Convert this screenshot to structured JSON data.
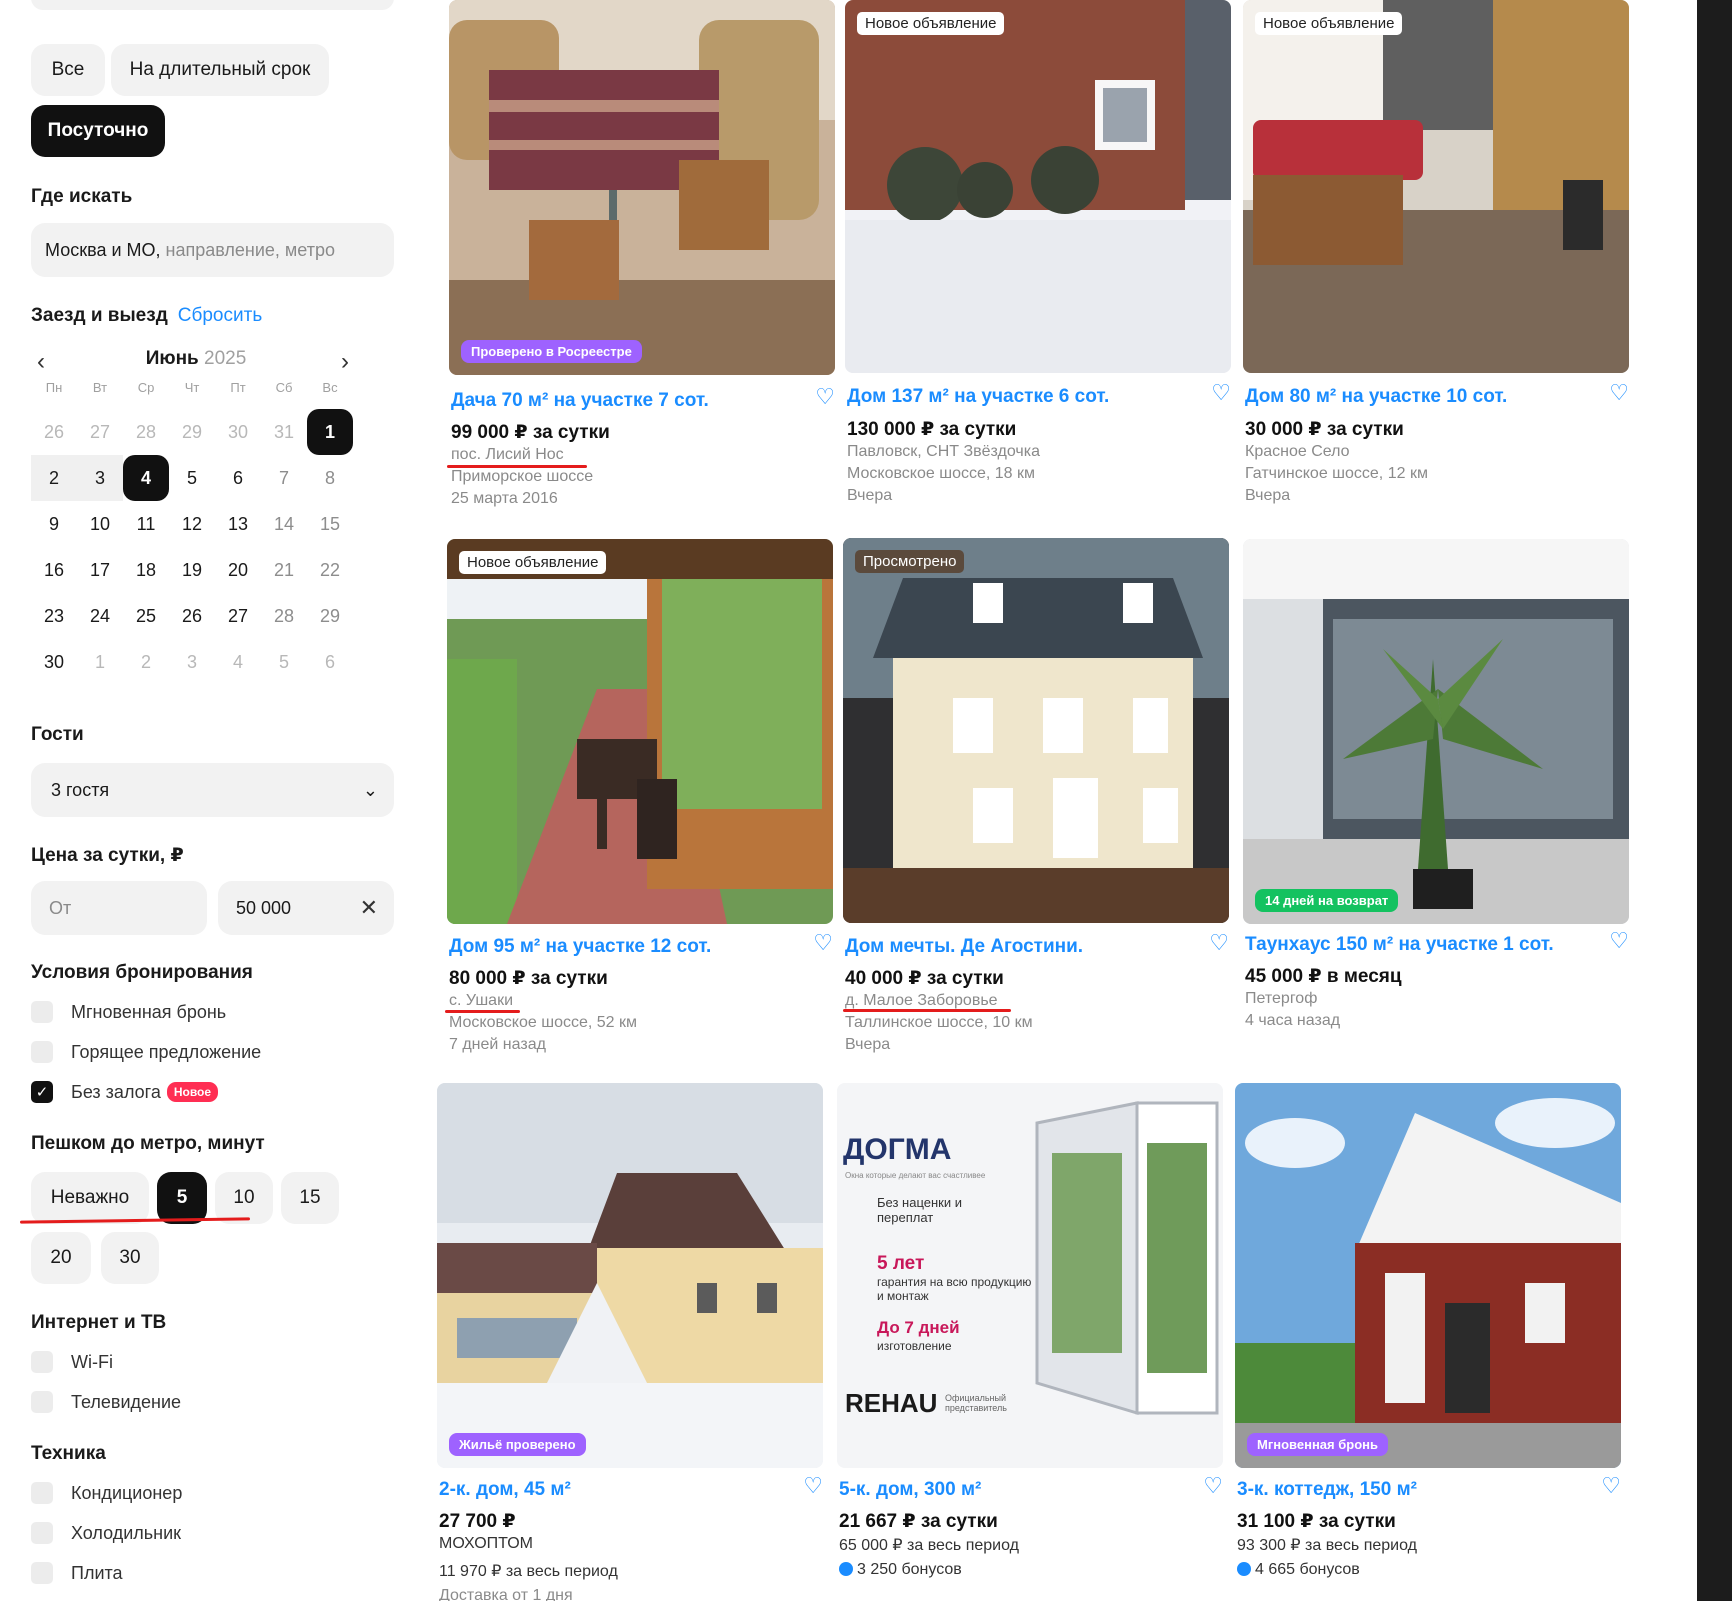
{
  "rent_type": {
    "all_label": "Все",
    "long_term_label": "На длительный срок",
    "daily_label": "Посуточно"
  },
  "where": {
    "title": "Где искать",
    "value": "Москва и МО,",
    "placeholder": "направление, метро"
  },
  "dates": {
    "title": "Заезд и выезд",
    "reset_label": "Сбросить",
    "month": "Июнь",
    "year": "2025",
    "weekdays": [
      "Пн",
      "Вт",
      "Ср",
      "Чт",
      "Пт",
      "Сб",
      "Вс"
    ],
    "days": [
      "26",
      "27",
      "28",
      "29",
      "30",
      "31",
      "1",
      "2",
      "3",
      "4",
      "5",
      "6",
      "7",
      "8",
      "9",
      "10",
      "11",
      "12",
      "13",
      "14",
      "15",
      "16",
      "17",
      "18",
      "19",
      "20",
      "21",
      "22",
      "23",
      "24",
      "25",
      "26",
      "27",
      "28",
      "29",
      "30",
      "1",
      "2",
      "3",
      "4",
      "5",
      "6"
    ]
  },
  "guests": {
    "title": "Гости",
    "value": "3 гостя"
  },
  "price": {
    "title": "Цена за сутки, ₽",
    "from_placeholder": "От",
    "to_value": "50 000"
  },
  "booking": {
    "title": "Условия бронирования",
    "instant": "Мгновенная бронь",
    "hot": "Горящее предложение",
    "no_deposit": "Без залога",
    "new_badge": "Новое"
  },
  "metro": {
    "title": "Пешком до метро, минут",
    "options": [
      "Неважно",
      "5",
      "10",
      "15",
      "20",
      "30"
    ]
  },
  "internet": {
    "title": "Интернет и ТВ",
    "wifi": "Wi-Fi",
    "tv": "Телевидение"
  },
  "appliances": {
    "title": "Техника",
    "ac": "Кондиционер",
    "fridge": "Холодильник",
    "stove": "Плита"
  },
  "cards": [
    {
      "title": "Дача 70 м² на участке 7 сот.",
      "price": "99 000 ₽ за сутки",
      "lines": [
        "пос. Лисий Нос",
        "Приморское шоссе",
        "25 марта 2016"
      ],
      "tag": "Проверено в Росреестре"
    },
    {
      "badge": "Новое объявление",
      "title": "Дом 137 м² на участке 6 сот.",
      "price": "130 000 ₽ за сутки",
      "lines": [
        "Павловск, СНТ Звёздочка",
        "Московское шоссе, 18 км",
        "Вчера"
      ]
    },
    {
      "badge": "Новое объявление",
      "title": "Дом 80 м² на участке 10 сот.",
      "price": "30 000 ₽ за сутки",
      "lines": [
        "Красное Село",
        "Гатчинское шоссе, 12 км",
        "Вчера"
      ]
    },
    {
      "badge": "Новое объявление",
      "title": "Дом 95 м² на участке 12 сот.",
      "price": "80 000 ₽ за сутки",
      "lines": [
        "с. Ушаки",
        "Московское шоссе, 52 км",
        "7 дней назад"
      ]
    },
    {
      "badge": "Просмотрено",
      "title": "Дом мечты. Де Агостини.",
      "price": "40 000 ₽ за сутки",
      "lines": [
        "д. Малое Заборовье",
        "Таллинское шоссе, 10 км",
        "Вчера"
      ]
    },
    {
      "title": "Таунхаус 150 м² на участке 1 сот.",
      "price": "45 000 ₽ в месяц",
      "lines": [
        "Петергоф",
        "4 часа назад"
      ],
      "tag": "14 дней на возврат"
    },
    {
      "title": "2-к. дом, 45 м²",
      "price": "27 700 ₽",
      "lines": [
        "МОХОПТОМ",
        "11 970 ₽ за весь период",
        "Доставка от 1 дня"
      ],
      "tag": "Жильё проверено"
    },
    {
      "title": "5-к. дом, 300 м²",
      "price": "21 667 ₽ за сутки",
      "lines": [
        "65 000 ₽ за весь период"
      ],
      "bonus": "3 250 бонусов"
    },
    {
      "title": "3-к. коттедж, 150 м²",
      "price": "31 100 ₽ за сутки",
      "lines": [
        "93 300 ₽ за весь период"
      ],
      "bonus": "4 665 бонусов",
      "tag": "Мгновенная бронь"
    }
  ],
  "ad": {
    "brand": "ДОГМА",
    "tagline": "Окна которые делают вас счастливее",
    "point1": "Без наценки и переплат",
    "point2_big": "5 лет",
    "point2": "гарантия на всю продукцию и монтаж",
    "point3_big": "До 7 дней",
    "point3": "изготовление",
    "rehau": "REHAU",
    "rehau_note": "Официальный представитель"
  },
  "colors": {
    "accent": "#1a8cff",
    "dark": "#111111",
    "badge_red": "#ff2e53",
    "annotation": "#e41c1c"
  }
}
